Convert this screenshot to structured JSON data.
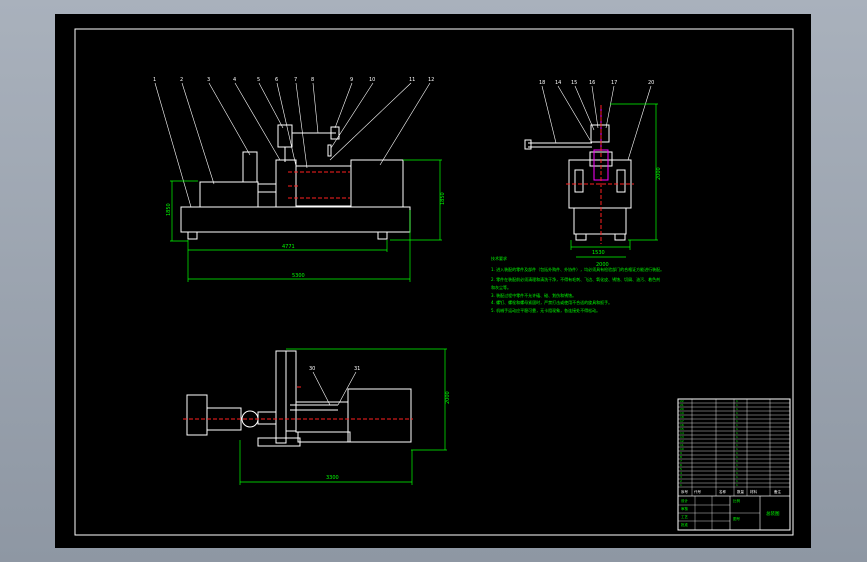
{
  "colors": {
    "background": "#a9b1bc",
    "paper": "#000000",
    "line": "#ffffff",
    "dimension": "#00ff00",
    "centerline": "#ff2020",
    "magenta": "#ff00ff",
    "text": "#00ff00"
  },
  "front_view": {
    "balloons": [
      "1",
      "2",
      "3",
      "4",
      "5",
      "6",
      "7",
      "8",
      "9",
      "10",
      "11",
      "12"
    ],
    "dims": {
      "height_left": "1850",
      "height_right": "1850",
      "length_inner": "4771",
      "length_overall": "5300"
    }
  },
  "side_view": {
    "balloons": [
      "18",
      "14",
      "15",
      "16",
      "17",
      "20"
    ],
    "dims": {
      "height": "2000",
      "width": "1530",
      "top": "2000"
    }
  },
  "top_view": {
    "balloons": [
      "30",
      "31"
    ],
    "dims": {
      "depth": "2000",
      "length": "3300"
    }
  },
  "notes": {
    "title": "技术要求",
    "lines": [
      "1. 进入装配的零件及部件（包括外购件、外协件），均必须具有检验部门的合格证方能进行装配。",
      "2. 零件在装配前必须清理和清洗干净，不得有毛刺、飞边、氧化皮、锈蚀、切屑、油污、着色剂",
      "和灰尘等。",
      "3. 装配过程中零件不允许磕、碰、划伤和锈蚀。",
      "4. 螺钉、螺栓和螺母紧固时，严禁打击或使用不合适的旋具和扳手。",
      "5. 机械手运动应平稳可靠，无卡阻现象，各连接处不得松动。"
    ]
  },
  "title_block": {
    "col_headers": [
      "序号",
      "代号",
      "名称",
      "数量",
      "材料",
      "备注"
    ],
    "rows": [
      [
        "22",
        "",
        "",
        "1",
        "",
        ""
      ],
      [
        "21",
        "",
        "",
        "1",
        "",
        ""
      ],
      [
        "20",
        "",
        "",
        "1",
        "",
        ""
      ],
      [
        "19",
        "",
        "",
        "1",
        "",
        ""
      ],
      [
        "18",
        "",
        "",
        "1",
        "",
        ""
      ],
      [
        "17",
        "",
        "",
        "1",
        "",
        ""
      ],
      [
        "16",
        "",
        "",
        "1",
        "",
        ""
      ],
      [
        "15",
        "",
        "",
        "1",
        "",
        ""
      ],
      [
        "14",
        "",
        "",
        "1",
        "",
        ""
      ],
      [
        "13",
        "",
        "",
        "1",
        "",
        ""
      ],
      [
        "12",
        "",
        "",
        "1",
        "",
        ""
      ],
      [
        "11",
        "",
        "",
        "1",
        "",
        ""
      ],
      [
        "10",
        "",
        "",
        "1",
        "",
        ""
      ],
      [
        "9",
        "",
        "",
        "1",
        "",
        ""
      ],
      [
        "8",
        "",
        "",
        "1",
        "",
        ""
      ],
      [
        "7",
        "",
        "",
        "1",
        "",
        ""
      ],
      [
        "6",
        "",
        "",
        "1",
        "",
        ""
      ],
      [
        "5",
        "",
        "",
        "1",
        "",
        ""
      ],
      [
        "4",
        "",
        "",
        "1",
        "",
        ""
      ],
      [
        "3",
        "",
        "",
        "1",
        "",
        ""
      ],
      [
        "2",
        "",
        "",
        "1",
        "",
        ""
      ],
      [
        "1",
        "",
        "",
        "1",
        "",
        ""
      ]
    ],
    "drawing_name": "总装图",
    "cells": [
      "设计",
      "审核",
      "工艺",
      "批准",
      "比例",
      "图号"
    ]
  }
}
